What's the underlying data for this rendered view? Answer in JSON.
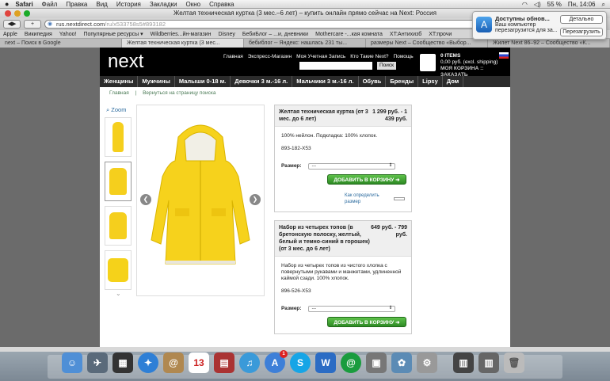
{
  "menubar": {
    "apple": "",
    "app": "Safari",
    "items": [
      "Файл",
      "Правка",
      "Вид",
      "История",
      "Закладки",
      "Окно",
      "Справка"
    ],
    "battery": "55 %",
    "clock": "Пн, 14:06"
  },
  "window": {
    "title": "Желтая техническая куртка (3 мес.–6 лет) – купить онлайн прямо сейчас на Next: Россия"
  },
  "toolbar": {
    "back": "◀",
    "forward": "▶",
    "url": "rus.nextdirect.com",
    "url_suffix": "/ru/x533758s5#893182"
  },
  "bookmarks": [
    "Apple",
    "Википедия",
    "Yahoo!",
    "Популярные ресурсы ▾",
    "Wildberries...йн-магазин",
    "Disney",
    "БебиБлог – ...и, дневники",
    "Mothercare -...кая комната",
    "XT:Антихизб",
    "XT:прочи"
  ],
  "tabs": [
    {
      "label": "next – Поиск в Google",
      "active": false
    },
    {
      "label": "Желтая техническая куртка (3 мес...",
      "active": true
    },
    {
      "label": "бебиблог -- Яндекс: нашлась 231 ты...",
      "active": false
    },
    {
      "label": "размеры Next – Сообщество «Выбор...",
      "active": false
    },
    {
      "label": "Жилет Next 86–92 – Сообщество «К...",
      "active": false
    }
  ],
  "notification": {
    "title": "Доступны обнов...",
    "text": "Ваш компьютер перезагрузится для за...",
    "btn_details": "Детально",
    "btn_restart": "Перезагрузить"
  },
  "site": {
    "logo": "next",
    "toplinks": [
      "Главная",
      "Экспресс-Магазин",
      "Моя Учетная Запись",
      "Кто Такие Next?",
      "Помощь"
    ],
    "search_button": "Поиск",
    "cart_items": "0 ITEMS",
    "cart_total": "0,00 руб. (excl. shipping)",
    "cart_link": "МОЯ КОРЗИНА :: ЗАКАЗАТЬ",
    "nav": [
      "Женщины",
      "Мужчины",
      "Малыши 0-18 м.",
      "Девочки 3 м.-16 л.",
      "Мальчики 3 м.-16 л.",
      "Обувь",
      "Бренды",
      "Lipsy",
      "Дом"
    ],
    "breadcrumb": [
      "Главная",
      "|",
      "Вернуться на страницу поиска"
    ],
    "zoom": "Zoom"
  },
  "product1": {
    "title": "Желтая техническая куртка (от 3 мес. до 6 лет)",
    "price": "1 299 руб. - 1 439 руб.",
    "desc": "100% нейлон. Подкладка: 100% хлопок.",
    "code": "893-182-X53",
    "size_label": "Размер:",
    "size_value": "---",
    "add_button": "ДОБАВИТЬ В КОРЗИНУ",
    "size_guide": "Как определить размер"
  },
  "product2": {
    "title": "Набор из четырех топов (в бретонскую полоску, желтый, белый и темно-синий в горошек) (от 3 мес. до 6 лет)",
    "price": "649 руб. - 799 руб.",
    "desc": "Набор из четырех топов из чистого хлопка с повернутыми рукавами и манжетами, удлиненной каймой сзади. 100% хлопок.",
    "code": "896-526-X53",
    "size_label": "Размер:",
    "size_value": "---",
    "add_button": "ДОБАВИТЬ В КОРЗИНУ"
  },
  "dock": {
    "badge": "1",
    "calendar_day": "13"
  }
}
